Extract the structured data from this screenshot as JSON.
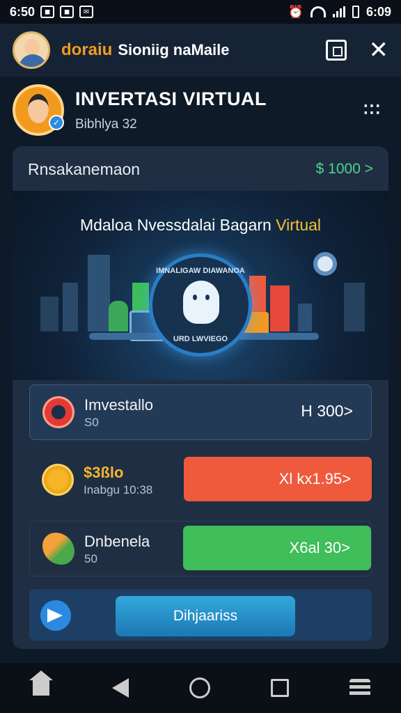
{
  "status_bar": {
    "time_left": "6:50",
    "time_right": "6:09"
  },
  "header": {
    "brand": "doraiu",
    "subtitle": "Sioniig naMaile"
  },
  "profile": {
    "title": "INVERTASI VIRTUAL",
    "subtitle": "Bibhlya 32"
  },
  "balance": {
    "label": "Rnsakanemaon",
    "value": "$ 1000 >"
  },
  "banner": {
    "title_part1": "Mdaloa Nvessdalai Bagarn ",
    "title_part2": "Virtual",
    "badge_top": "IMNALIGAW DIAWANOA",
    "badge_bottom": "URD LWVIEGO"
  },
  "rows": [
    {
      "title": "Imvestallo",
      "subtitle": "S0",
      "value": "H 300>",
      "icon": "target-icon"
    },
    {
      "title": "$3ßlo",
      "subtitle": "Inabgu 10:38",
      "value": "Xl kx1.95>",
      "icon": "coin-icon",
      "accent": "#ef5a3c"
    },
    {
      "title": "Dnbenela",
      "subtitle": "50",
      "value": "X6al 30>",
      "icon": "leaf-icon",
      "accent": "#3fbe5a"
    }
  ],
  "bottom_action": {
    "label": "Dihjaariss",
    "icon": "send-icon"
  },
  "colors": {
    "background": "#0f1a28",
    "card": "#1f2e42",
    "accent_green": "#4cd58a",
    "accent_red": "#ef5a3c",
    "accent_gold": "#f3c33a"
  }
}
